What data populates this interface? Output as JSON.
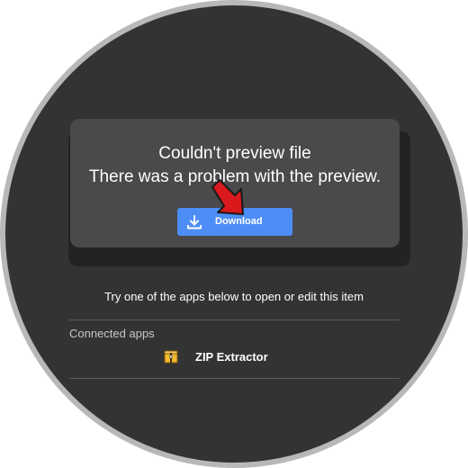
{
  "preview_error": {
    "title": "Couldn't preview file",
    "message": "There was a problem with the preview.",
    "download_label": "Download",
    "download_icon": "download-icon",
    "button_color": "#4d8df6",
    "annotation_icon": "red-arrow-icon"
  },
  "apps": {
    "hint": "Try one of the apps below to open or edit this item",
    "section_label": "Connected apps",
    "items": [
      {
        "label": "ZIP Extractor",
        "icon": "zip-extractor-icon"
      }
    ]
  },
  "colors": {
    "background": "#333333",
    "card": "#4a494b",
    "frame": "#b8b8b8"
  }
}
